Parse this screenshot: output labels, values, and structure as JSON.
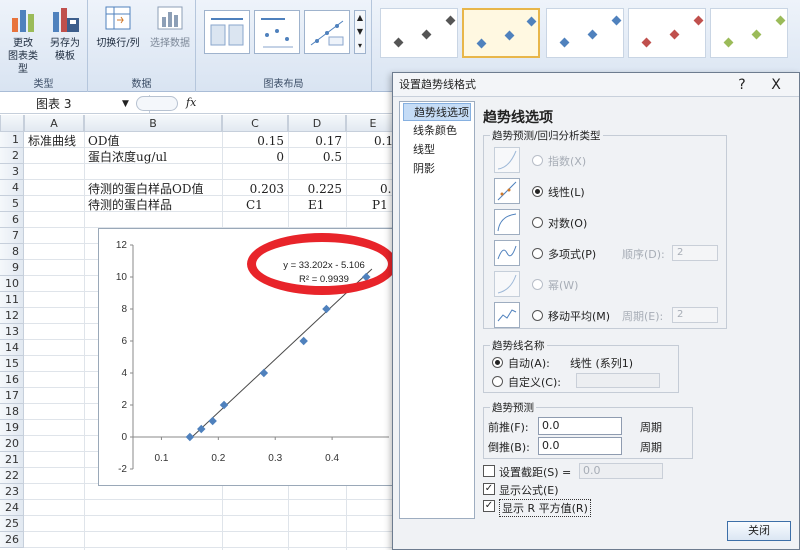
{
  "ribbon": {
    "buttons": [
      {
        "label1": "更改",
        "label2": "图表类型"
      },
      {
        "label1": "另存为",
        "label2": "模板"
      },
      {
        "label1": "切换行/列",
        "label2": ""
      },
      {
        "label1": "选择数据",
        "label2": ""
      }
    ],
    "groups": [
      "类型",
      "数据",
      "图表布局"
    ]
  },
  "formula_bar": {
    "name_box": "图表 3",
    "fx": "fx"
  },
  "sheet": {
    "columns": [
      "A",
      "B",
      "C",
      "D",
      "E"
    ],
    "rows": [
      "1",
      "2",
      "3",
      "4",
      "5",
      "6",
      "7",
      "8",
      "9",
      "10",
      "11",
      "12",
      "13",
      "14",
      "15",
      "16",
      "17",
      "18",
      "19",
      "20",
      "21",
      "22",
      "23",
      "24",
      "25",
      "26"
    ],
    "cells": {
      "A1": "标准曲线",
      "B1": "OD值",
      "C1": "0.15",
      "D1": "0.17",
      "E1": "0.1",
      "B2": "蛋白浓度ug/ul",
      "C2": "0",
      "D2": "0.5",
      "B4": "待测的蛋白样品OD值",
      "C4": "0.203",
      "D4": "0.225",
      "E4": "0.",
      "B5": "待测的蛋白样品",
      "C5": "C1",
      "D5": "E1",
      "E5": "P1"
    }
  },
  "chart": {
    "equation": "y = 33.202x - 5.106",
    "r2": "R² = 0.9939",
    "y_ticks": [
      "12",
      "10",
      "8",
      "6",
      "4",
      "2",
      "0",
      "-2"
    ],
    "x_ticks": [
      "0.1",
      "0.2",
      "0.3",
      "0.4"
    ]
  },
  "chart_data": {
    "type": "scatter",
    "x": [
      0.15,
      0.17,
      0.19,
      0.21,
      0.28,
      0.35,
      0.39,
      0.46
    ],
    "y": [
      0,
      0.5,
      1,
      2,
      4,
      6,
      8,
      10
    ],
    "trendline": {
      "slope": 33.202,
      "intercept": -5.106
    },
    "xlim": [
      0.05,
      0.5
    ],
    "ylim": [
      -2,
      12
    ],
    "grid": false,
    "color": "#4f81bd"
  },
  "dialog": {
    "title": "设置趋势线格式",
    "help": "?",
    "close_x": "X",
    "nav": [
      "趋势线选项",
      "线条颜色",
      "线型",
      "阴影"
    ],
    "heading": "趋势线选项",
    "group_type": "趋势预测/回归分析类型",
    "options": [
      "指数(X)",
      "线性(L)",
      "对数(O)",
      "多项式(P)",
      "幂(W)",
      "移动平均(M)"
    ],
    "order_label": "顺序(D):",
    "order_value": "2",
    "period_label": "周期(E):",
    "period_value": "2",
    "group_name": "趋势线名称",
    "auto_label": "自动(A):",
    "auto_value": "线性 (系列1)",
    "custom_label": "自定义(C):",
    "group_forecast": "趋势预测",
    "forward_label": "前推(F):",
    "forward_value": "0.0",
    "backward_label": "倒推(B):",
    "backward_value": "0.0",
    "period_unit": "周期",
    "intercept_label": "设置截距(S) =",
    "intercept_value": "0.0",
    "show_equation": "显示公式(E)",
    "show_r2": "显示 R 平方值(R)",
    "close_button": "关闭"
  },
  "colors": {
    "accent": "#4f81bd",
    "highlight": "#e8242a"
  }
}
